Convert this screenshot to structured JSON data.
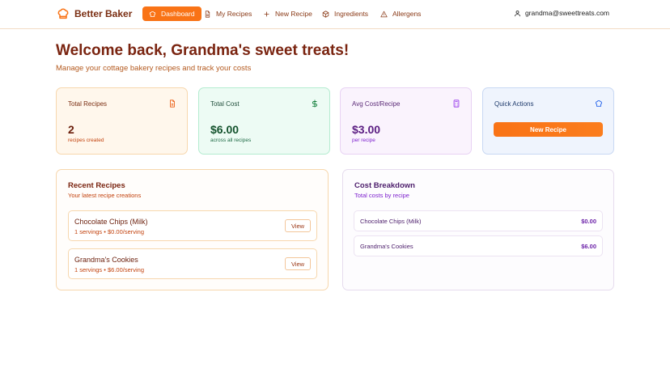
{
  "nav": {
    "brand": "Better Baker",
    "items": [
      {
        "label": "Dashboard",
        "icon": "chef-hat-icon",
        "active": true
      },
      {
        "label": "My Recipes",
        "icon": "document-icon"
      },
      {
        "label": "New Recipe",
        "icon": "plus-icon"
      },
      {
        "label": "Ingredients",
        "icon": "package-icon"
      },
      {
        "label": "Allergens",
        "icon": "warning-icon"
      }
    ],
    "user_email": "grandma@sweettreats.com"
  },
  "header": {
    "title": "Welcome back, Grandma's sweet treats!",
    "subtitle": "Manage your cottage bakery recipes and track your costs"
  },
  "stats": {
    "total_recipes": {
      "label": "Total Recipes",
      "value": "2",
      "note": "recipes created"
    },
    "total_cost": {
      "label": "Total Cost",
      "value": "$6.00",
      "note": "across all recipes"
    },
    "avg_cost": {
      "label": "Avg Cost/Recipe",
      "value": "$3.00",
      "note": "per recipe"
    },
    "quick_actions": {
      "label": "Quick Actions",
      "button": "New Recipe"
    }
  },
  "recent": {
    "title": "Recent Recipes",
    "subtitle": "Your latest recipe creations",
    "view_label": "View",
    "items": [
      {
        "name": "Chocolate Chips (Milk)",
        "meta": "1 servings • $0.00/serving"
      },
      {
        "name": "Grandma's Cookies",
        "meta": "1 servings • $6.00/serving"
      }
    ]
  },
  "costs": {
    "title": "Cost Breakdown",
    "subtitle": "Total costs by recipe",
    "items": [
      {
        "name": "Chocolate Chips (Milk)",
        "value": "$0.00"
      },
      {
        "name": "Grandma's Cookies",
        "value": "$6.00"
      }
    ]
  },
  "colors": {
    "accent": "#f97316",
    "brand_text": "#7a2e12"
  }
}
